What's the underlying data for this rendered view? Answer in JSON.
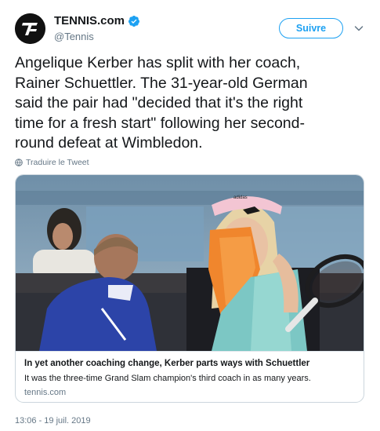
{
  "author": {
    "name": "TENNIS.com",
    "handle": "@Tennis",
    "verified": true,
    "avatar_icon": "tennis-logo-icon"
  },
  "follow_button": {
    "label": "Suivre"
  },
  "menu_icon": "chevron-down-icon",
  "tweet": {
    "text": "Angelique Kerber has split with her coach,\nRainer Schuettler. The 31-year-old German\nsaid the pair had \"decided that it's the right\ntime for a fresh start\" following her second-\nround defeat at Wimbledon.",
    "translate_label": "Traduire le Tweet",
    "timestamp": "13:06 - 19 juil. 2019"
  },
  "card": {
    "title": "In yet another coaching change, Kerber parts ways with Schuettler",
    "description": "It was the three-time Grand Slam champion's third coach in as many years.",
    "domain": "tennis.com",
    "image_brand": "adidas"
  },
  "colors": {
    "accent": "#1da1f2",
    "text_primary": "#14171a",
    "text_secondary": "#657786",
    "border": "#ccd6dd"
  }
}
